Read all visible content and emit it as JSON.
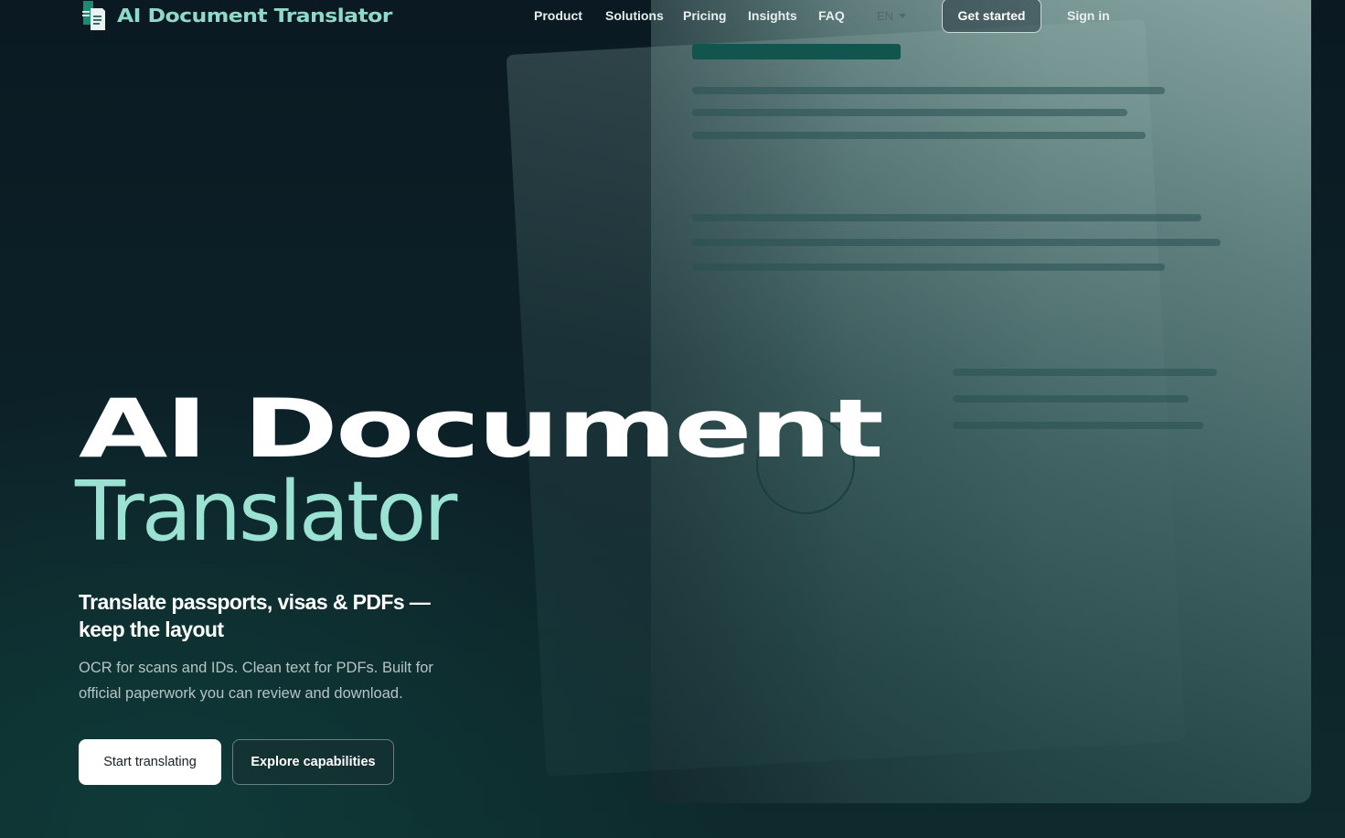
{
  "brand": {
    "name": "AI Document Translator",
    "accent_color": "#9be2d2"
  },
  "nav": {
    "links": [
      "Product",
      "Solutions",
      "Pricing",
      "Insights",
      "FAQ"
    ],
    "language": "EN",
    "get_started": "Get started",
    "sign_in": "Sign in"
  },
  "hero": {
    "title_line1": "AI Document",
    "title_line2": "Translator",
    "subheadline": "Translate passports, visas & PDFs — keep the layout",
    "description": "OCR for scans and IDs. Clean text for PDFs. Built for official paperwork you can review and download.",
    "primary_cta": "Start translating",
    "secondary_cta": "Explore capabilities"
  },
  "icons": {
    "logo": "document-translate-icon",
    "language_caret": "chevron-down-icon"
  }
}
